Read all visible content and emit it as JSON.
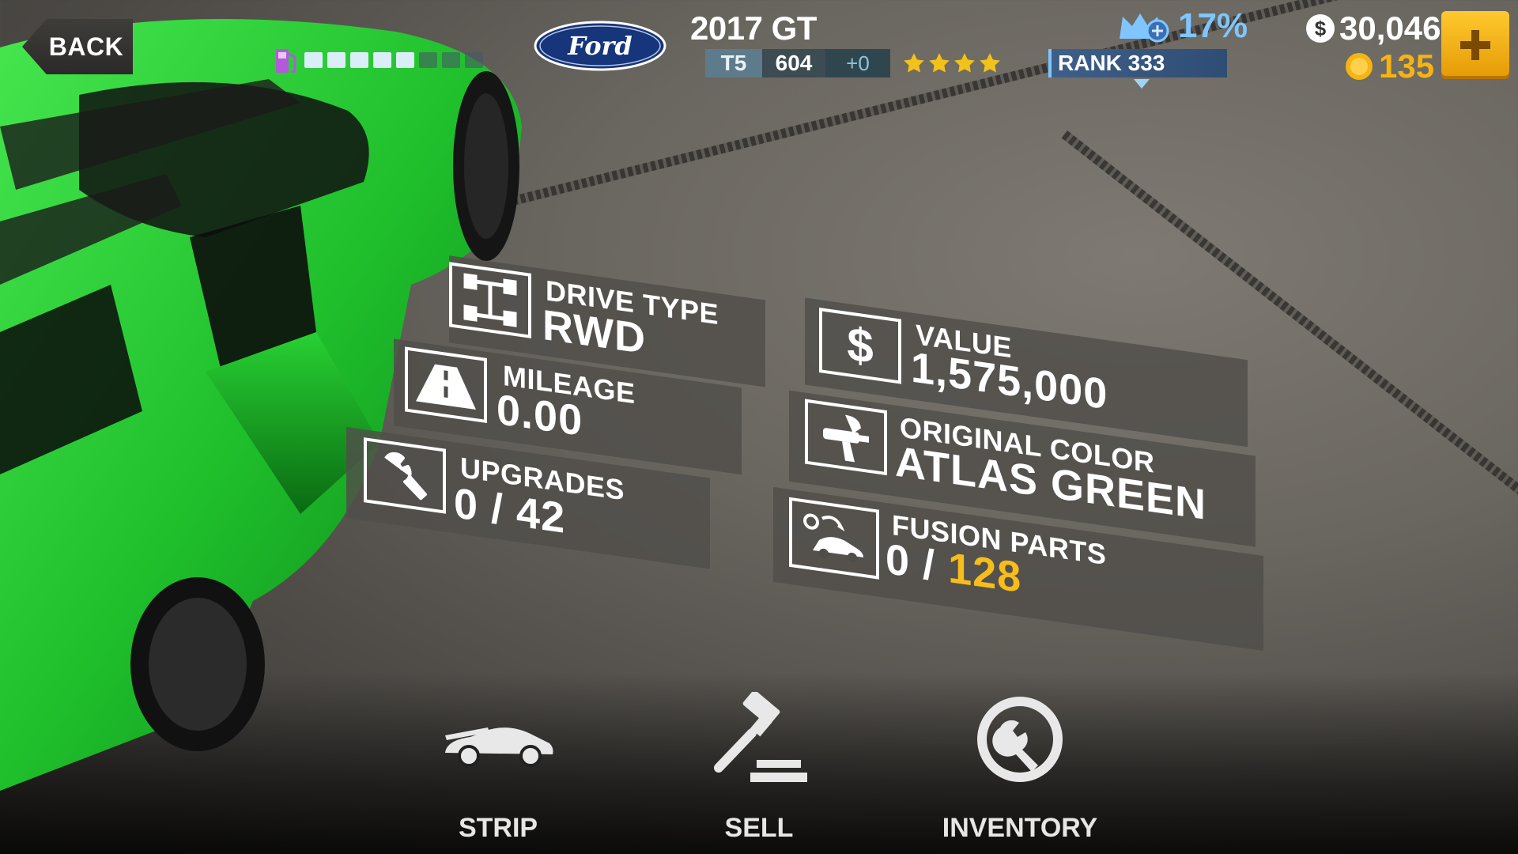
{
  "topbar": {
    "back_label": "BACK",
    "fuel": {
      "filled": 5,
      "total": 8
    },
    "brand_logo": "Ford",
    "car_title": "2017 GT",
    "tier": "T5",
    "performance": "604",
    "performance_delta": "+0",
    "stars": 4,
    "rp_percent": "17%",
    "rank": "RANK 333",
    "cash": "30,046",
    "gold": "135"
  },
  "info": {
    "drive_type": {
      "label": "DRIVE TYPE",
      "value": "RWD",
      "icon": "drivetrain-icon"
    },
    "mileage": {
      "label": "MILEAGE",
      "value": "0.00",
      "icon": "road-icon"
    },
    "upgrades": {
      "label": "UPGRADES",
      "value": "0 / 42",
      "icon": "wrench-icon"
    },
    "value": {
      "label": "VALUE",
      "value": "1,575,000",
      "icon": "dollar-icon"
    },
    "original_color": {
      "label": "ORIGINAL COLOR",
      "value": "ATLAS GREEN",
      "icon": "spray-gun-icon"
    },
    "fusion_parts": {
      "label": "FUSION PARTS",
      "owned": "0 /",
      "total": "128",
      "icon": "fusion-car-icon"
    }
  },
  "actions": [
    {
      "label": "STRIP",
      "icon": "car-hood-icon"
    },
    {
      "label": "SELL",
      "icon": "gavel-icon"
    },
    {
      "label": "INVENTORY",
      "icon": "inventory-wrench-icon"
    }
  ],
  "colors": {
    "car": "#1fbf2c",
    "gold": "#f7bd1a",
    "rp_blue": "#7fc6ff"
  }
}
